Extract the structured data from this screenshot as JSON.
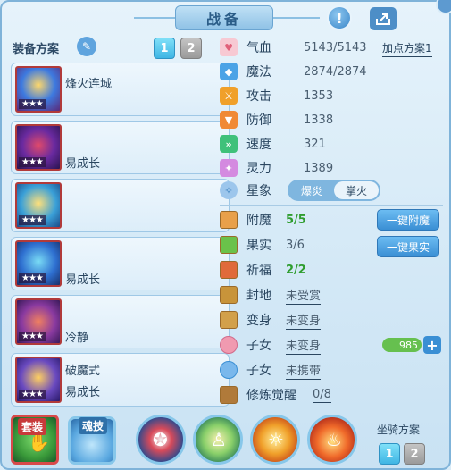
{
  "title": "战备",
  "left": {
    "scheme_label": "装备方案",
    "tabs": [
      "1",
      "2"
    ],
    "equipment": [
      {
        "name": "烽火连城",
        "stars": "★★★",
        "sub": ""
      },
      {
        "name": "",
        "stars": "★★★",
        "sub": "易成长"
      },
      {
        "name": "",
        "stars": "★★★",
        "sub": ""
      },
      {
        "name": "",
        "stars": "★★★",
        "sub": "易成长"
      },
      {
        "name": "",
        "stars": "★★★",
        "sub": "冷静"
      },
      {
        "name": "破魔式",
        "stars": "★★★",
        "sub": "易成长"
      }
    ]
  },
  "stats": {
    "plus_scheme": "加点方案1",
    "items": [
      {
        "name": "气血",
        "value": "5143/5143",
        "icon": "heart-icon",
        "color": "#e0607a"
      },
      {
        "name": "魔法",
        "value": "2874/2874",
        "icon": "mana-icon",
        "color": "#4ba3e6"
      },
      {
        "name": "攻击",
        "value": "1353",
        "icon": "attack-icon",
        "color": "#f0a02a"
      },
      {
        "name": "防御",
        "value": "1338",
        "icon": "defense-icon",
        "color": "#f08a36"
      },
      {
        "name": "速度",
        "value": "321",
        "icon": "speed-icon",
        "color": "#3fc17a"
      },
      {
        "name": "灵力",
        "value": "1389",
        "icon": "spirit-icon",
        "color": "#d48ae0"
      }
    ],
    "star_label": "星象",
    "star_options": [
      "爆炎",
      "掌火"
    ]
  },
  "details": [
    {
      "name": "附魔",
      "value": "5/5",
      "green": true
    },
    {
      "name": "果实",
      "value": "3/6",
      "green": false
    },
    {
      "name": "祈福",
      "value": "2/2",
      "green": true
    },
    {
      "name": "封地",
      "value": "未受赏",
      "green": false
    },
    {
      "name": "变身",
      "value": "未变身",
      "green": false
    },
    {
      "name": "子女",
      "value": "未变身",
      "green": false
    },
    {
      "name": "子女",
      "value": "未携带",
      "green": false
    },
    {
      "name": "修炼觉醒",
      "value": "0/8",
      "green": false
    }
  ],
  "buttons": {
    "enchant": "一键附魔",
    "fruit": "一键果实"
  },
  "pet_value": "985",
  "bottom": {
    "suit_label": "套装",
    "soul_label": "魂技",
    "mount_label": "坐骑方案",
    "mount_tabs": [
      "1",
      "2"
    ]
  },
  "colors": {
    "accent": "#3a8fd4",
    "tab_active": "#3fb5e4",
    "green": "#2f9d2f"
  }
}
